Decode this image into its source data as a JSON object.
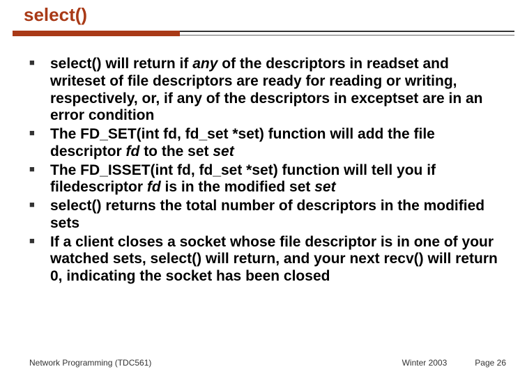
{
  "title": "select()",
  "bullets": [
    {
      "html": "select() will return if <span class='it'>any</span> of the descriptors in readset and writeset of file descriptors are ready for reading or writing, respectively, or, if any of the descriptors in exceptset are in an error condition"
    },
    {
      "html": "The FD_SET(int fd, fd_set *set) function will add the file descriptor <span class='it'>fd</span> to the set <span class='it'>set</span>"
    },
    {
      "html": "The FD_ISSET(int fd, fd_set *set) function will tell you if filedescriptor <span class='it'>fd</span> is in the modified set <span class='it'>set</span>"
    },
    {
      "html": "select() returns the total number of descriptors in the modified sets"
    },
    {
      "html": "If a client closes a socket whose file descriptor is in one of your watched sets, select() will return, and your next recv() will return 0, indicating the socket has been closed"
    }
  ],
  "footer": {
    "left": "Network Programming (TDC561)",
    "center": "Winter 2003",
    "right": "Page 26"
  }
}
